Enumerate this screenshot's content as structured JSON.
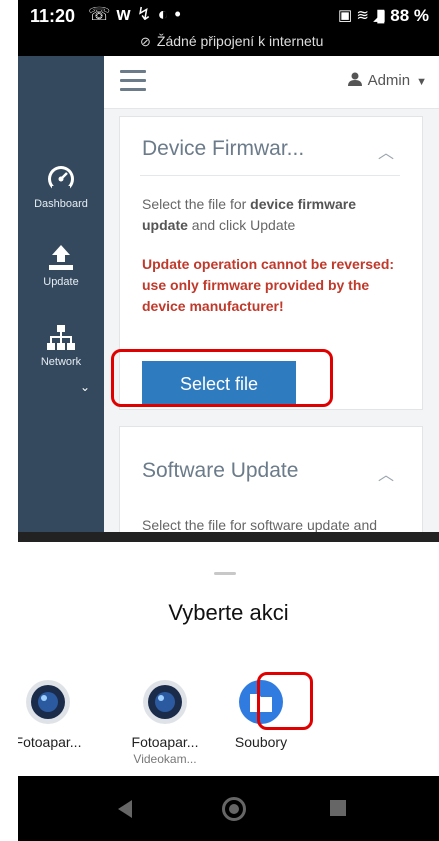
{
  "status_bar": {
    "time": "11:20",
    "battery": "88 %",
    "network_message": "Žádné připojení k internetu"
  },
  "header": {
    "user": "Admin"
  },
  "sidebar": {
    "items": [
      {
        "label": "Dashboard",
        "icon": "gauge-icon"
      },
      {
        "label": "Update",
        "icon": "upload-icon"
      },
      {
        "label": "Network",
        "icon": "network-icon"
      }
    ]
  },
  "firmware_card": {
    "title": "Device Firmwar...",
    "desc_part1": "Select the file for ",
    "desc_bold": "device firmware update",
    "desc_part2": " and click Update",
    "warning": "Update operation cannot be reversed: use only firmware provided by the device manufacturer!",
    "button_label": "Select file"
  },
  "software_card": {
    "title": "Software Update",
    "desc": "Select the file for software update and"
  },
  "chooser": {
    "title": "Vyberte akci",
    "options": [
      {
        "name": "Fotoapar...",
        "sub": ""
      },
      {
        "name": "Fotoapar...",
        "sub": "Videokam..."
      },
      {
        "name": "Soubory",
        "sub": ""
      }
    ]
  },
  "colors": {
    "sidebar_bg": "#34495e",
    "button_bg": "#2f7bbf",
    "warning_text": "#c0392b",
    "highlight": "#e10000"
  }
}
